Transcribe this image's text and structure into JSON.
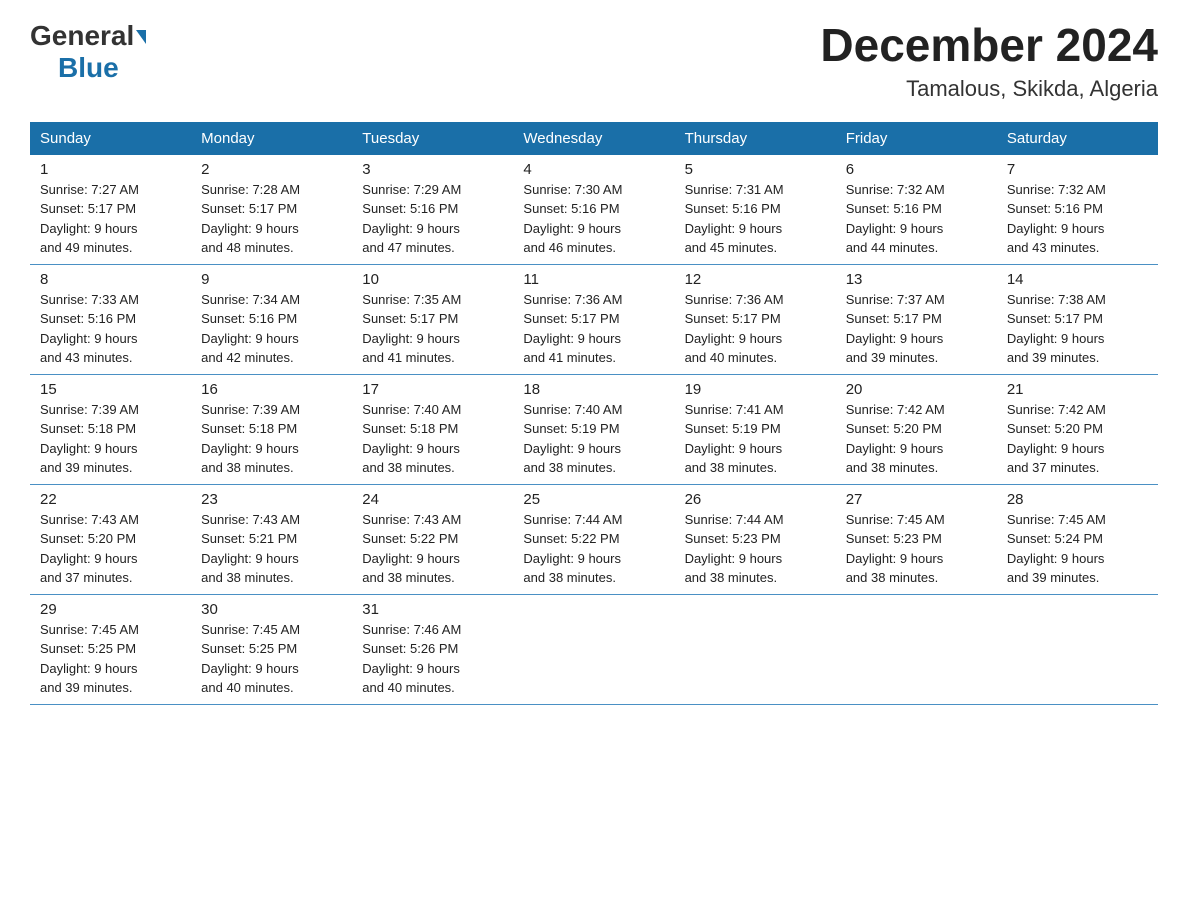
{
  "logo": {
    "general": "General",
    "blue": "Blue",
    "arrow": "▶"
  },
  "title": "December 2024",
  "subtitle": "Tamalous, Skikda, Algeria",
  "days_of_week": [
    "Sunday",
    "Monday",
    "Tuesday",
    "Wednesday",
    "Thursday",
    "Friday",
    "Saturday"
  ],
  "weeks": [
    [
      {
        "day": "1",
        "sunrise": "7:27 AM",
        "sunset": "5:17 PM",
        "daylight": "9 hours and 49 minutes."
      },
      {
        "day": "2",
        "sunrise": "7:28 AM",
        "sunset": "5:17 PM",
        "daylight": "9 hours and 48 minutes."
      },
      {
        "day": "3",
        "sunrise": "7:29 AM",
        "sunset": "5:16 PM",
        "daylight": "9 hours and 47 minutes."
      },
      {
        "day": "4",
        "sunrise": "7:30 AM",
        "sunset": "5:16 PM",
        "daylight": "9 hours and 46 minutes."
      },
      {
        "day": "5",
        "sunrise": "7:31 AM",
        "sunset": "5:16 PM",
        "daylight": "9 hours and 45 minutes."
      },
      {
        "day": "6",
        "sunrise": "7:32 AM",
        "sunset": "5:16 PM",
        "daylight": "9 hours and 44 minutes."
      },
      {
        "day": "7",
        "sunrise": "7:32 AM",
        "sunset": "5:16 PM",
        "daylight": "9 hours and 43 minutes."
      }
    ],
    [
      {
        "day": "8",
        "sunrise": "7:33 AM",
        "sunset": "5:16 PM",
        "daylight": "9 hours and 43 minutes."
      },
      {
        "day": "9",
        "sunrise": "7:34 AM",
        "sunset": "5:16 PM",
        "daylight": "9 hours and 42 minutes."
      },
      {
        "day": "10",
        "sunrise": "7:35 AM",
        "sunset": "5:17 PM",
        "daylight": "9 hours and 41 minutes."
      },
      {
        "day": "11",
        "sunrise": "7:36 AM",
        "sunset": "5:17 PM",
        "daylight": "9 hours and 41 minutes."
      },
      {
        "day": "12",
        "sunrise": "7:36 AM",
        "sunset": "5:17 PM",
        "daylight": "9 hours and 40 minutes."
      },
      {
        "day": "13",
        "sunrise": "7:37 AM",
        "sunset": "5:17 PM",
        "daylight": "9 hours and 39 minutes."
      },
      {
        "day": "14",
        "sunrise": "7:38 AM",
        "sunset": "5:17 PM",
        "daylight": "9 hours and 39 minutes."
      }
    ],
    [
      {
        "day": "15",
        "sunrise": "7:39 AM",
        "sunset": "5:18 PM",
        "daylight": "9 hours and 39 minutes."
      },
      {
        "day": "16",
        "sunrise": "7:39 AM",
        "sunset": "5:18 PM",
        "daylight": "9 hours and 38 minutes."
      },
      {
        "day": "17",
        "sunrise": "7:40 AM",
        "sunset": "5:18 PM",
        "daylight": "9 hours and 38 minutes."
      },
      {
        "day": "18",
        "sunrise": "7:40 AM",
        "sunset": "5:19 PM",
        "daylight": "9 hours and 38 minutes."
      },
      {
        "day": "19",
        "sunrise": "7:41 AM",
        "sunset": "5:19 PM",
        "daylight": "9 hours and 38 minutes."
      },
      {
        "day": "20",
        "sunrise": "7:42 AM",
        "sunset": "5:20 PM",
        "daylight": "9 hours and 38 minutes."
      },
      {
        "day": "21",
        "sunrise": "7:42 AM",
        "sunset": "5:20 PM",
        "daylight": "9 hours and 37 minutes."
      }
    ],
    [
      {
        "day": "22",
        "sunrise": "7:43 AM",
        "sunset": "5:20 PM",
        "daylight": "9 hours and 37 minutes."
      },
      {
        "day": "23",
        "sunrise": "7:43 AM",
        "sunset": "5:21 PM",
        "daylight": "9 hours and 38 minutes."
      },
      {
        "day": "24",
        "sunrise": "7:43 AM",
        "sunset": "5:22 PM",
        "daylight": "9 hours and 38 minutes."
      },
      {
        "day": "25",
        "sunrise": "7:44 AM",
        "sunset": "5:22 PM",
        "daylight": "9 hours and 38 minutes."
      },
      {
        "day": "26",
        "sunrise": "7:44 AM",
        "sunset": "5:23 PM",
        "daylight": "9 hours and 38 minutes."
      },
      {
        "day": "27",
        "sunrise": "7:45 AM",
        "sunset": "5:23 PM",
        "daylight": "9 hours and 38 minutes."
      },
      {
        "day": "28",
        "sunrise": "7:45 AM",
        "sunset": "5:24 PM",
        "daylight": "9 hours and 39 minutes."
      }
    ],
    [
      {
        "day": "29",
        "sunrise": "7:45 AM",
        "sunset": "5:25 PM",
        "daylight": "9 hours and 39 minutes."
      },
      {
        "day": "30",
        "sunrise": "7:45 AM",
        "sunset": "5:25 PM",
        "daylight": "9 hours and 40 minutes."
      },
      {
        "day": "31",
        "sunrise": "7:46 AM",
        "sunset": "5:26 PM",
        "daylight": "9 hours and 40 minutes."
      },
      null,
      null,
      null,
      null
    ]
  ],
  "labels": {
    "sunrise": "Sunrise:",
    "sunset": "Sunset:",
    "daylight": "Daylight:"
  }
}
